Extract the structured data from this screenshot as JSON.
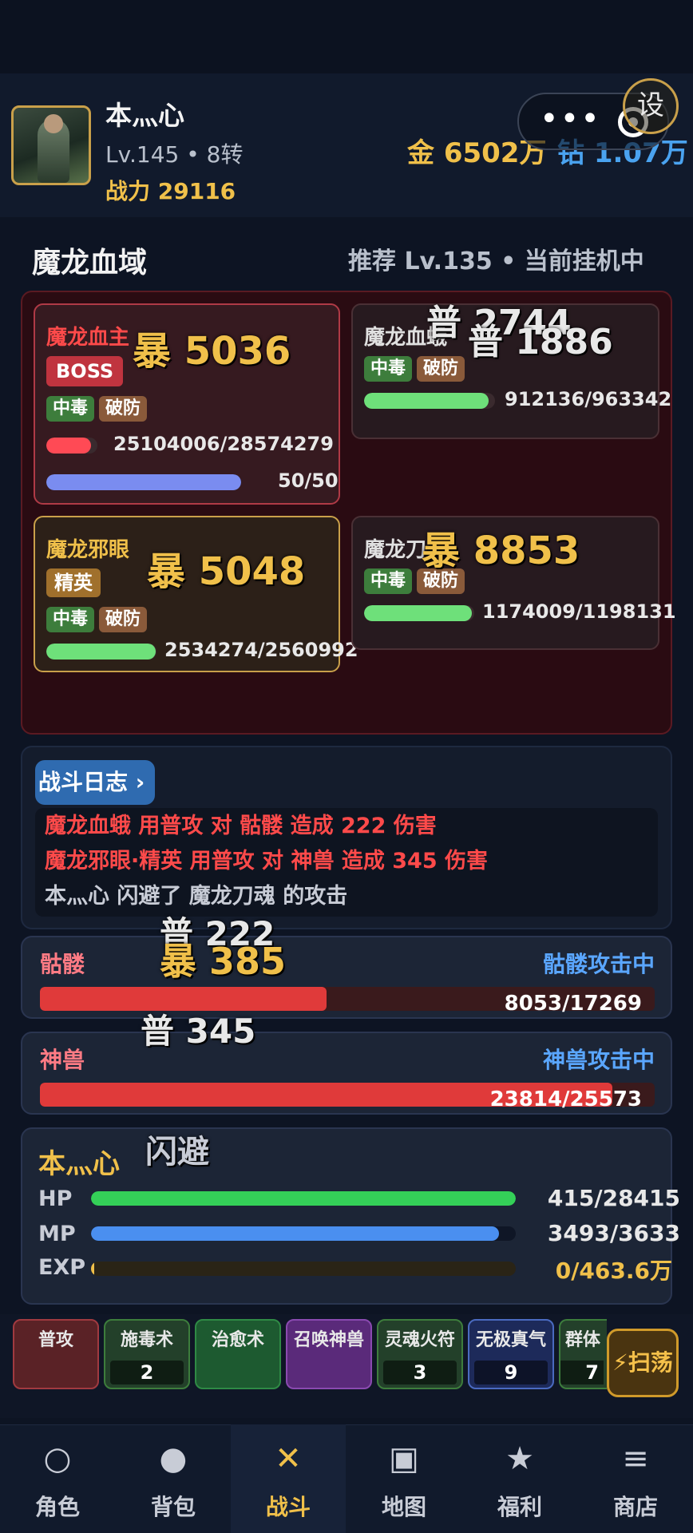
{
  "player": {
    "name": "本灬心",
    "level_text": "Lv.145 • 8转",
    "power_text": "战力 29116",
    "gold_text": "金 6502万",
    "diamond_text": "钻 1.07万",
    "settings_label": "设"
  },
  "capsule": {
    "more_label": "•••"
  },
  "zone": {
    "name": "魔龙血域",
    "info": "推荐 Lv.135 • 当前挂机中"
  },
  "enemies": [
    {
      "name": "魔龙血主",
      "tags": [
        "BOSS",
        "中毒",
        "破防"
      ],
      "hp_text": "25104006/28574279",
      "hp_fraction": 0.88,
      "mp_text": "50/50",
      "mp_fraction": 1.0
    },
    {
      "name": "魔龙血蛾",
      "tags": [
        "中毒",
        "破防"
      ],
      "hp_text": "912136/963342",
      "hp_fraction": 0.95
    },
    {
      "name": "魔龙邪眼",
      "tags": [
        "精英",
        "中毒",
        "破防"
      ],
      "hp_text": "2534274/2560992",
      "hp_fraction": 0.99
    },
    {
      "name": "魔龙刀",
      "tags": [
        "中毒",
        "破防"
      ],
      "hp_text": "1174009/1198131",
      "hp_fraction": 0.98
    }
  ],
  "floats": [
    {
      "text": "暴 5036",
      "color": "#f0c04a"
    },
    {
      "text": "普 2744",
      "color": "#e8e8e8"
    },
    {
      "text": "普 1886",
      "color": "#e8e8e8"
    },
    {
      "text": "暴 5048",
      "color": "#f0c04a"
    },
    {
      "text": "暴 8853",
      "color": "#f0c04a"
    },
    {
      "text": "普 222",
      "color": "#e8e8e8"
    },
    {
      "text": "暴 385",
      "color": "#f0c04a"
    },
    {
      "text": "普 345",
      "color": "#e8e8e8"
    },
    {
      "text": "闪避",
      "color": "#c8ccd6"
    }
  ],
  "log": {
    "title": "战斗日志 ›",
    "lines": [
      {
        "text": "魔龙血蛾 用普攻 对 骷髅 造成 222 伤害",
        "color": "#ff4a4a"
      },
      {
        "text": "魔龙邪眼·精英 用普攻 对 神兽 造成 345 伤害",
        "color": "#ff4a4a"
      },
      {
        "text": "本灬心 闪避了 魔龙刀魂 的攻击",
        "color": "#c8ccd6"
      }
    ]
  },
  "pets": [
    {
      "name": "骷髅",
      "state": "骷髅攻击中",
      "hp_text": "8053/17269",
      "hp_fraction": 0.466
    },
    {
      "name": "神兽",
      "state": "神兽攻击中",
      "hp_text": "23814/25573",
      "hp_fraction": 0.931
    }
  ],
  "hero": {
    "name": "本灬心",
    "hp_label": "HP",
    "hp_text": "415/28415",
    "hp_fraction": 1.0,
    "mp_label": "MP",
    "mp_text": "3493/3633",
    "mp_fraction": 0.96,
    "exp_label": "EXP",
    "exp_text": "0/463.6万",
    "exp_fraction": 0.0,
    "colors": {
      "hp": "#34d058",
      "mp": "#4a8ff0",
      "exp": "#f0c04a"
    }
  },
  "skills": [
    {
      "label": "普攻",
      "count": "",
      "color": "#5a2226",
      "border": "#a03a40"
    },
    {
      "label": "施毒术",
      "count": "2",
      "color": "#23402a",
      "border": "#3d7d3c"
    },
    {
      "label": "治愈术",
      "count": "",
      "color": "#1d5a30",
      "border": "#2f8a45"
    },
    {
      "label": "召唤神兽",
      "count": "",
      "color": "#5a2a7a",
      "border": "#8a4ab0"
    },
    {
      "label": "灵魂火符",
      "count": "3",
      "color": "#23402a",
      "border": "#3d7d3c"
    },
    {
      "label": "无极真气",
      "count": "9",
      "color": "#1d2a5a",
      "border": "#4a6ac0"
    },
    {
      "label": "群体",
      "count": "7",
      "color": "#23402a",
      "border": "#3d7d3c"
    }
  ],
  "sweep_label": "⚡扫荡",
  "nav": [
    {
      "label": "角色",
      "icon": "○",
      "icon_name": "character-icon"
    },
    {
      "label": "背包",
      "icon": "●",
      "icon_name": "bag-icon"
    },
    {
      "label": "战斗",
      "icon": "✕",
      "icon_name": "battle-icon"
    },
    {
      "label": "地图",
      "icon": "▣",
      "icon_name": "map-icon"
    },
    {
      "label": "福利",
      "icon": "★",
      "icon_name": "welfare-icon"
    },
    {
      "label": "商店",
      "icon": "≡",
      "icon_name": "shop-icon"
    }
  ]
}
